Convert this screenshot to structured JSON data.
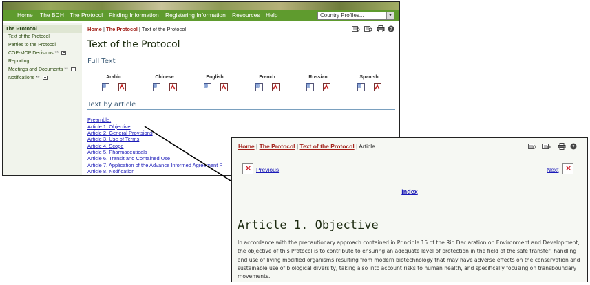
{
  "main": {
    "nav": [
      "Home",
      "The BCH",
      "The Protocol",
      "Finding Information",
      "Registering Information",
      "Resources",
      "Help"
    ],
    "country_select": "Country Profiles...",
    "sidebar": {
      "heading": "The Protocol",
      "items": [
        {
          "label": "Text of the Protocol",
          "marker": ""
        },
        {
          "label": "Parties to the Protocol",
          "marker": ""
        },
        {
          "label": "COP-MOP Decisions",
          "marker": "**"
        },
        {
          "label": "Reporting",
          "marker": ""
        },
        {
          "label": "Meetings and Documents",
          "marker": "**"
        },
        {
          "label": "Notifications",
          "marker": "**"
        }
      ]
    },
    "breadcrumb": {
      "home": "Home",
      "protocol": "The Protocol",
      "current": "Text of the Protocol",
      "separator": "|"
    },
    "title": "Text of the Protocol",
    "full_text_heading": "Full Text",
    "languages": [
      "Arabic",
      "Chinese",
      "English",
      "French",
      "Russian",
      "Spanish"
    ],
    "by_article_heading": "Text by article",
    "articles": [
      "Preamble.",
      "Article 1. Objective",
      "Article 2. General Provisions",
      "Article 3. Use of Terms",
      "Article 4. Scope",
      "Article 5. Pharmaceuticals",
      "Article 6. Transit and Contained Use",
      "Article 7. Application of the Advance Informed Agreement P",
      "Article 8. Notification"
    ]
  },
  "overlay": {
    "breadcrumb": {
      "home": "Home",
      "protocol": "The Protocol",
      "text": "Text of the Protocol",
      "current": "Article",
      "separator": "|"
    },
    "previous_label": "Previous",
    "next_label": "Next",
    "index_label": "Index",
    "article_title": "Article 1. Objective",
    "article_body": "In accordance with the precautionary approach contained in Principle 15 of the Rio Declaration on Environment and Development, the objective of this Protocol is to contribute to ensuring an adequate level of protection in the field of the safe transfer, handling and use of living modified organisms resulting from modern biotechnology that may have adverse effects on the conservation and sustainable use of biological diversity, taking also into account risks to human health, and specifically focusing on transboundary movements."
  },
  "colors": {
    "nav_green": "#5f9b2e",
    "breadcrumb_red": "#a3231c",
    "link_blue": "#1b1bb8",
    "heading_blue": "#3d5c77",
    "sidebar_bg": "#f1f4ec"
  }
}
